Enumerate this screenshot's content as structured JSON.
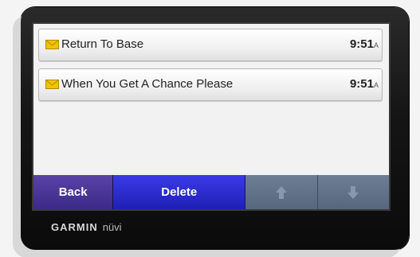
{
  "messages": [
    {
      "title": "Return To Base",
      "time": "9:51",
      "ampm": "A"
    },
    {
      "title": "When You Get A Chance Please",
      "time": "9:51",
      "ampm": "A"
    }
  ],
  "toolbar": {
    "back_label": "Back",
    "delete_label": "Delete",
    "up_icon": "arrow-up-icon",
    "down_icon": "arrow-down-icon"
  },
  "device": {
    "brand": "GARMIN",
    "model": "nüvi"
  },
  "colors": {
    "back_button": "#3f2f90",
    "delete_button": "#2424c8",
    "scroll_buttons": "#5f7088",
    "screen_bg": "#f2f2f2",
    "envelope": "#f2c200"
  }
}
